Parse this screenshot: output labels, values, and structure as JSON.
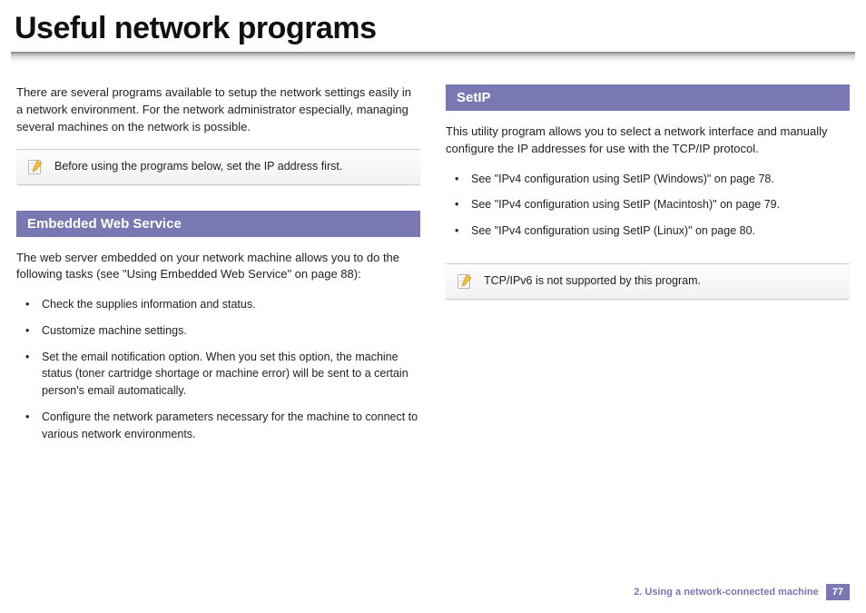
{
  "title": "Useful network programs",
  "intro": "There are several programs available to setup the network settings easily in a network environment. For the network administrator especially, managing several machines on the network is possible.",
  "note1": "Before using the programs below, set the IP address first.",
  "left": {
    "heading": "Embedded Web Service",
    "para": "The web server embedded on your network machine allows you to do the following tasks (see \"Using Embedded Web Service\" on page 88):",
    "items": [
      "Check the supplies information and status.",
      "Customize machine settings.",
      "Set the email notification option. When you set this option, the machine status (toner cartridge shortage or machine error) will be sent to a certain person's email automatically.",
      "Configure the network parameters necessary for the machine to connect to various network environments."
    ]
  },
  "right": {
    "heading": "SetIP",
    "para": "This utility program allows you to select a network interface and manually configure the IP addresses for use with the TCP/IP protocol.",
    "items": [
      "See \"IPv4 configuration using SetIP (Windows)\" on page 78.",
      "See \"IPv4 configuration using SetIP (Macintosh)\" on page 79.",
      "See \"IPv4 configuration using SetIP (Linux)\" on page 80."
    ],
    "note": "TCP/IPv6 is not supported by this program."
  },
  "footer": {
    "chapter": "2.  Using a network-connected machine",
    "page": "77"
  }
}
